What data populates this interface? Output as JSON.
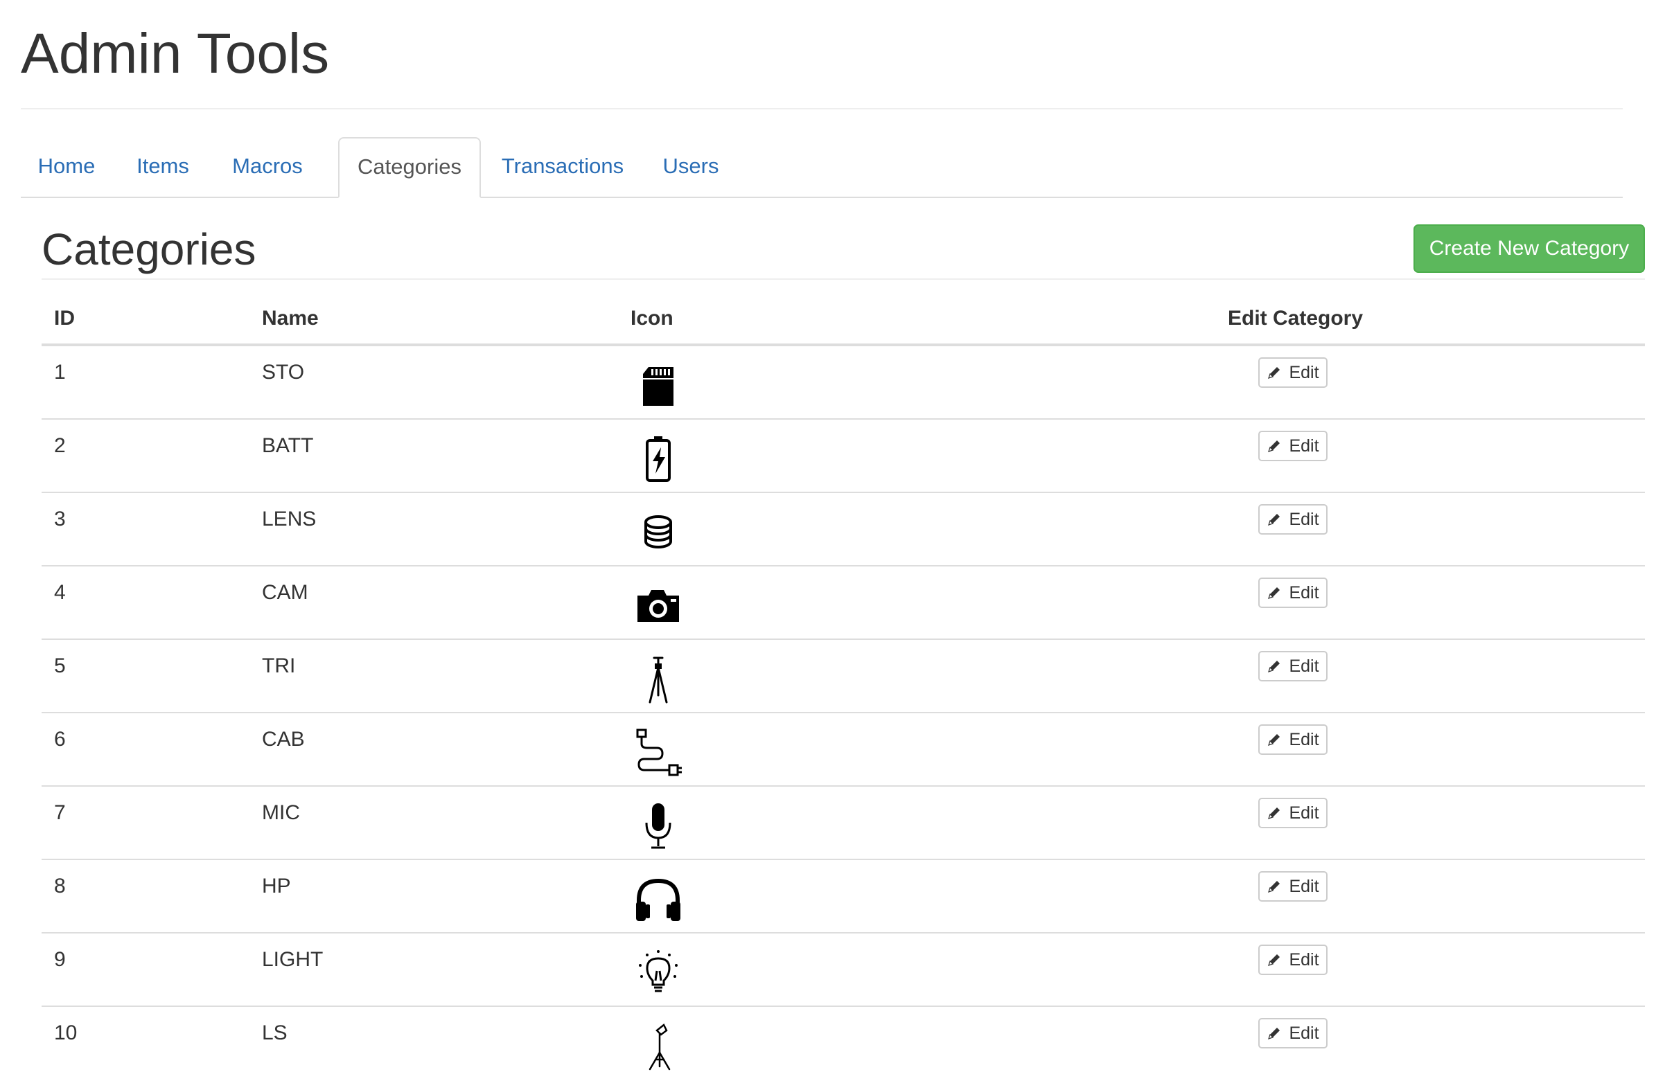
{
  "app": {
    "title": "Admin Tools"
  },
  "tabs": [
    {
      "label": "Home",
      "active": false
    },
    {
      "label": "Items",
      "active": false
    },
    {
      "label": "Macros",
      "active": false
    },
    {
      "label": "Categories",
      "active": true
    },
    {
      "label": "Transactions",
      "active": false
    },
    {
      "label": "Users",
      "active": false
    }
  ],
  "colors": {
    "link": "#2a6db5",
    "success": "#5cb85c",
    "text": "#333333",
    "border": "#dddddd"
  },
  "section": {
    "title": "Categories",
    "create_label": "Create New Category"
  },
  "table": {
    "headers": {
      "id": "ID",
      "name": "Name",
      "icon": "Icon",
      "edit": "Edit Category"
    },
    "rows": [
      {
        "id": "1",
        "name": "STO",
        "icon": "sd-card-icon",
        "edit_label": "Edit"
      },
      {
        "id": "2",
        "name": "BATT",
        "icon": "battery-icon",
        "edit_label": "Edit"
      },
      {
        "id": "3",
        "name": "LENS",
        "icon": "lens-icon",
        "edit_label": "Edit"
      },
      {
        "id": "4",
        "name": "CAM",
        "icon": "camera-icon",
        "edit_label": "Edit"
      },
      {
        "id": "5",
        "name": "TRI",
        "icon": "tripod-icon",
        "edit_label": "Edit"
      },
      {
        "id": "6",
        "name": "CAB",
        "icon": "cable-icon",
        "edit_label": "Edit"
      },
      {
        "id": "7",
        "name": "MIC",
        "icon": "microphone-icon",
        "edit_label": "Edit"
      },
      {
        "id": "8",
        "name": "HP",
        "icon": "headphones-icon",
        "edit_label": "Edit"
      },
      {
        "id": "9",
        "name": "LIGHT",
        "icon": "lightbulb-icon",
        "edit_label": "Edit"
      },
      {
        "id": "10",
        "name": "LS",
        "icon": "light-stand-icon",
        "edit_label": "Edit"
      }
    ]
  }
}
